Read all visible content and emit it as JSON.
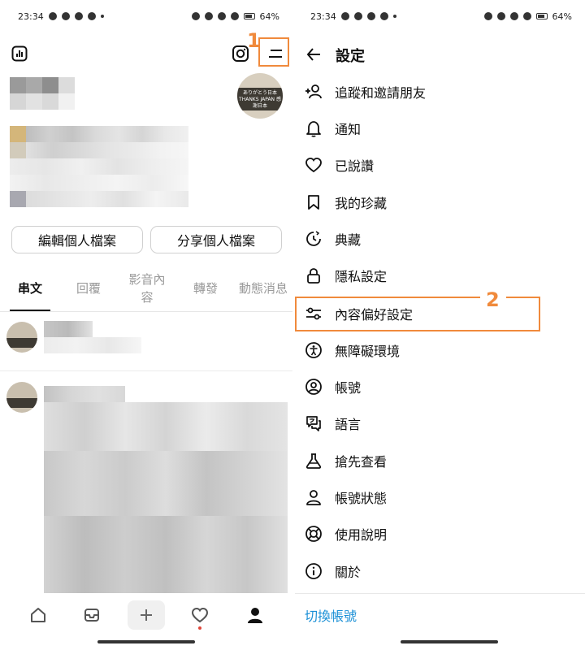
{
  "status_bar": {
    "time": "23:34",
    "battery": "64%"
  },
  "left": {
    "buttons": {
      "edit_profile": "編輯個人檔案",
      "share_profile": "分享個人檔案"
    },
    "tabs": [
      {
        "label": "串文",
        "active": true
      },
      {
        "label": "回覆",
        "active": false
      },
      {
        "label": "影音內容",
        "active": false
      },
      {
        "label": "轉發",
        "active": false
      },
      {
        "label": "動態消息",
        "active": false
      }
    ],
    "avatar_text": "ありがとう日本 THANKS JAPAN 感謝日本",
    "annotation_1": "1"
  },
  "right": {
    "title": "設定",
    "menu": [
      {
        "label": "追蹤和邀請朋友",
        "icon": "add-person-icon"
      },
      {
        "label": "通知",
        "icon": "bell-icon"
      },
      {
        "label": "已說讚",
        "icon": "heart-icon"
      },
      {
        "label": "我的珍藏",
        "icon": "bookmark-icon"
      },
      {
        "label": "典藏",
        "icon": "archive-clock-icon"
      },
      {
        "label": "隱私設定",
        "icon": "lock-icon"
      },
      {
        "label": "內容偏好設定",
        "icon": "sliders-icon"
      },
      {
        "label": "無障礙環境",
        "icon": "accessibility-icon"
      },
      {
        "label": "帳號",
        "icon": "account-circle-icon"
      },
      {
        "label": "語言",
        "icon": "language-icon"
      },
      {
        "label": "搶先查看",
        "icon": "flask-icon"
      },
      {
        "label": "帳號狀態",
        "icon": "person-icon"
      },
      {
        "label": "使用說明",
        "icon": "lifebuoy-icon"
      },
      {
        "label": "關於",
        "icon": "info-icon"
      }
    ],
    "switch_account": "切換帳號",
    "annotation_2": "2",
    "link_color": "#1a8fd6",
    "annotation_color": "#f08a3c"
  }
}
